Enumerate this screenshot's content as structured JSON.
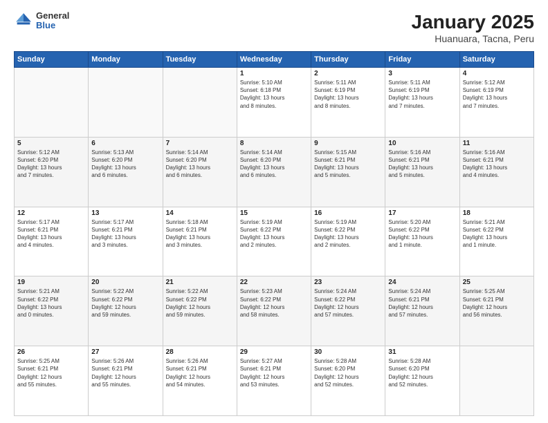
{
  "header": {
    "logo": {
      "general": "General",
      "blue": "Blue"
    },
    "title": "January 2025",
    "subtitle": "Huanuara, Tacna, Peru"
  },
  "days_of_week": [
    "Sunday",
    "Monday",
    "Tuesday",
    "Wednesday",
    "Thursday",
    "Friday",
    "Saturday"
  ],
  "weeks": [
    [
      {
        "day": "",
        "content": ""
      },
      {
        "day": "",
        "content": ""
      },
      {
        "day": "",
        "content": ""
      },
      {
        "day": "1",
        "content": "Sunrise: 5:10 AM\nSunset: 6:18 PM\nDaylight: 13 hours\nand 8 minutes."
      },
      {
        "day": "2",
        "content": "Sunrise: 5:11 AM\nSunset: 6:19 PM\nDaylight: 13 hours\nand 8 minutes."
      },
      {
        "day": "3",
        "content": "Sunrise: 5:11 AM\nSunset: 6:19 PM\nDaylight: 13 hours\nand 7 minutes."
      },
      {
        "day": "4",
        "content": "Sunrise: 5:12 AM\nSunset: 6:19 PM\nDaylight: 13 hours\nand 7 minutes."
      }
    ],
    [
      {
        "day": "5",
        "content": "Sunrise: 5:12 AM\nSunset: 6:20 PM\nDaylight: 13 hours\nand 7 minutes."
      },
      {
        "day": "6",
        "content": "Sunrise: 5:13 AM\nSunset: 6:20 PM\nDaylight: 13 hours\nand 6 minutes."
      },
      {
        "day": "7",
        "content": "Sunrise: 5:14 AM\nSunset: 6:20 PM\nDaylight: 13 hours\nand 6 minutes."
      },
      {
        "day": "8",
        "content": "Sunrise: 5:14 AM\nSunset: 6:20 PM\nDaylight: 13 hours\nand 6 minutes."
      },
      {
        "day": "9",
        "content": "Sunrise: 5:15 AM\nSunset: 6:21 PM\nDaylight: 13 hours\nand 5 minutes."
      },
      {
        "day": "10",
        "content": "Sunrise: 5:16 AM\nSunset: 6:21 PM\nDaylight: 13 hours\nand 5 minutes."
      },
      {
        "day": "11",
        "content": "Sunrise: 5:16 AM\nSunset: 6:21 PM\nDaylight: 13 hours\nand 4 minutes."
      }
    ],
    [
      {
        "day": "12",
        "content": "Sunrise: 5:17 AM\nSunset: 6:21 PM\nDaylight: 13 hours\nand 4 minutes."
      },
      {
        "day": "13",
        "content": "Sunrise: 5:17 AM\nSunset: 6:21 PM\nDaylight: 13 hours\nand 3 minutes."
      },
      {
        "day": "14",
        "content": "Sunrise: 5:18 AM\nSunset: 6:21 PM\nDaylight: 13 hours\nand 3 minutes."
      },
      {
        "day": "15",
        "content": "Sunrise: 5:19 AM\nSunset: 6:22 PM\nDaylight: 13 hours\nand 2 minutes."
      },
      {
        "day": "16",
        "content": "Sunrise: 5:19 AM\nSunset: 6:22 PM\nDaylight: 13 hours\nand 2 minutes."
      },
      {
        "day": "17",
        "content": "Sunrise: 5:20 AM\nSunset: 6:22 PM\nDaylight: 13 hours\nand 1 minute."
      },
      {
        "day": "18",
        "content": "Sunrise: 5:21 AM\nSunset: 6:22 PM\nDaylight: 13 hours\nand 1 minute."
      }
    ],
    [
      {
        "day": "19",
        "content": "Sunrise: 5:21 AM\nSunset: 6:22 PM\nDaylight: 13 hours\nand 0 minutes."
      },
      {
        "day": "20",
        "content": "Sunrise: 5:22 AM\nSunset: 6:22 PM\nDaylight: 12 hours\nand 59 minutes."
      },
      {
        "day": "21",
        "content": "Sunrise: 5:22 AM\nSunset: 6:22 PM\nDaylight: 12 hours\nand 59 minutes."
      },
      {
        "day": "22",
        "content": "Sunrise: 5:23 AM\nSunset: 6:22 PM\nDaylight: 12 hours\nand 58 minutes."
      },
      {
        "day": "23",
        "content": "Sunrise: 5:24 AM\nSunset: 6:22 PM\nDaylight: 12 hours\nand 57 minutes."
      },
      {
        "day": "24",
        "content": "Sunrise: 5:24 AM\nSunset: 6:21 PM\nDaylight: 12 hours\nand 57 minutes."
      },
      {
        "day": "25",
        "content": "Sunrise: 5:25 AM\nSunset: 6:21 PM\nDaylight: 12 hours\nand 56 minutes."
      }
    ],
    [
      {
        "day": "26",
        "content": "Sunrise: 5:25 AM\nSunset: 6:21 PM\nDaylight: 12 hours\nand 55 minutes."
      },
      {
        "day": "27",
        "content": "Sunrise: 5:26 AM\nSunset: 6:21 PM\nDaylight: 12 hours\nand 55 minutes."
      },
      {
        "day": "28",
        "content": "Sunrise: 5:26 AM\nSunset: 6:21 PM\nDaylight: 12 hours\nand 54 minutes."
      },
      {
        "day": "29",
        "content": "Sunrise: 5:27 AM\nSunset: 6:21 PM\nDaylight: 12 hours\nand 53 minutes."
      },
      {
        "day": "30",
        "content": "Sunrise: 5:28 AM\nSunset: 6:20 PM\nDaylight: 12 hours\nand 52 minutes."
      },
      {
        "day": "31",
        "content": "Sunrise: 5:28 AM\nSunset: 6:20 PM\nDaylight: 12 hours\nand 52 minutes."
      },
      {
        "day": "",
        "content": ""
      }
    ]
  ]
}
